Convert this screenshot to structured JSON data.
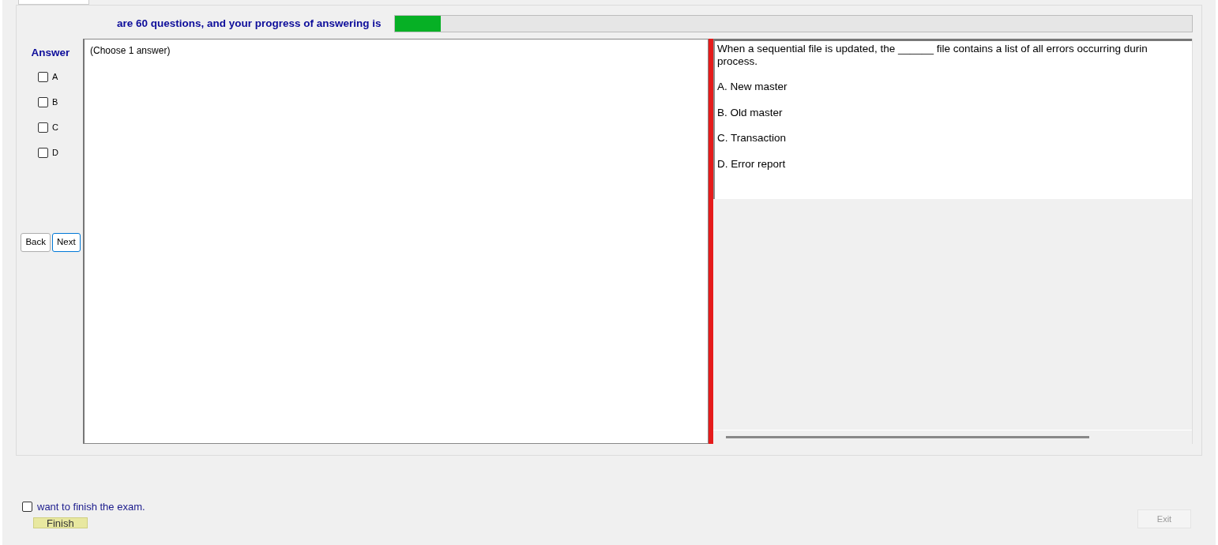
{
  "header": {
    "text": "are 60 questions, and your progress of answering is",
    "progress": {
      "level": 0.058
    }
  },
  "answer_panel": {
    "title": "Answer",
    "options": [
      {
        "label": "A",
        "checked": false
      },
      {
        "label": "B",
        "checked": false
      },
      {
        "label": "C",
        "checked": false
      },
      {
        "label": "D",
        "checked": false
      }
    ],
    "buttons": [
      {
        "label": "Back",
        "focused": false
      },
      {
        "label": "Next",
        "focused": true
      }
    ]
  },
  "instruction": "(Choose 1 answer)",
  "question": {
    "text": "When a sequential file is updated, the ______ file contains a list of all errors occurring durin",
    "text_cont": "process.",
    "choices": [
      "A.  New master",
      "B.  Old master",
      "C.  Transaction",
      "D.  Error report"
    ]
  },
  "finish": {
    "label": "want to finish the exam.",
    "checked": false,
    "button": "Finish"
  },
  "exit_button": {
    "label": "Exit",
    "disabled": true
  }
}
